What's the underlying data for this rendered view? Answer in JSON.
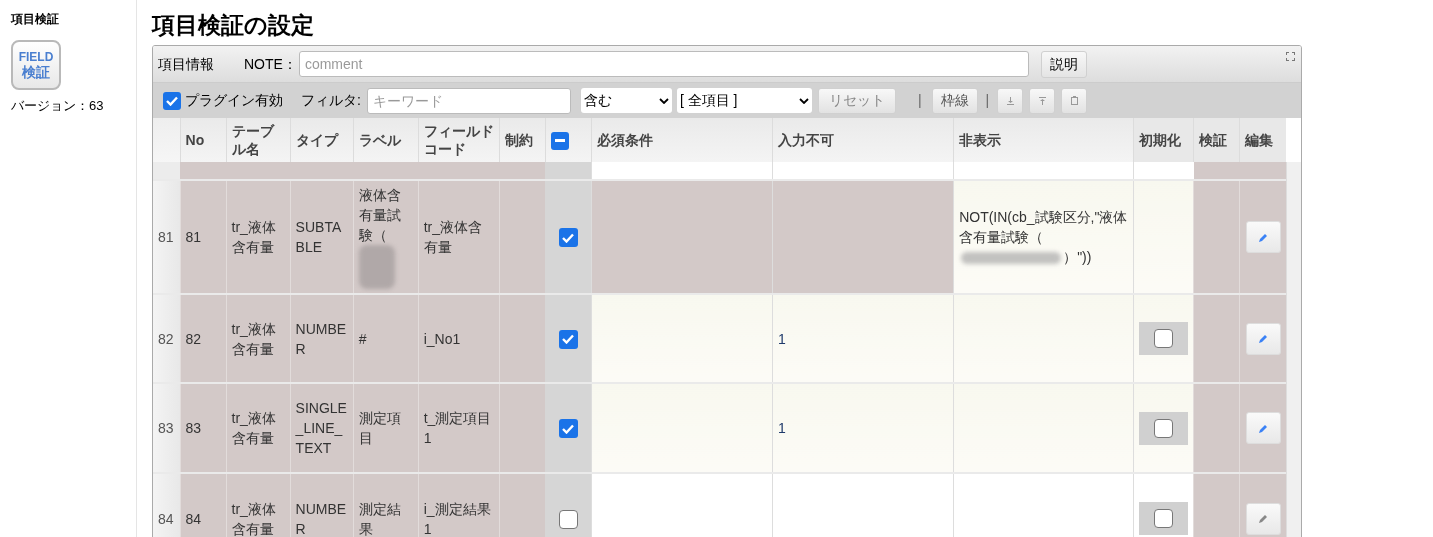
{
  "sidebar": {
    "title": "項目検証",
    "logo": {
      "line1": "FIELD",
      "line2": "検証"
    },
    "version": "バージョン：63"
  },
  "page_title": "項目検証の設定",
  "toolbar": {
    "label": "項目情報",
    "note_label": "NOTE：",
    "note": {
      "placeholder": "comment"
    },
    "help_button": "説明"
  },
  "filterbar": {
    "plugin_enabled": {
      "label": "プラグイン有効",
      "checked": true
    },
    "filter_label": "フィルタ:",
    "keyword": {
      "placeholder": "キーワード"
    },
    "match": "含む",
    "scope": "[ 全項目 ]",
    "reset_button": "リセット",
    "separator_1": "|",
    "border_button": "枠線",
    "separator_2": "|"
  },
  "table": {
    "columns": [
      "No",
      "テーブル名",
      "タイプ",
      "ラベル",
      "フィールドコード",
      "制約",
      "",
      "必須条件",
      "入力不可",
      "非表示",
      "初期化",
      "検証",
      "編集"
    ],
    "select_all_indeterminate": true,
    "rows": [
      {
        "row_number": "81",
        "no": "81",
        "table": "tr_液体含有量",
        "type": "SUBTABLE",
        "label": "液体含有量試験（",
        "field_code": "tr_液体含有量",
        "checked": true,
        "required": {
          "kind": "locked"
        },
        "readonly": {
          "kind": "locked"
        },
        "hidden": {
          "kind": "filled",
          "value": "NOT(IN(cb_試験区分,\"液体含有量試験（",
          "redacted": true,
          "tail": "）\"))"
        },
        "init": null,
        "edit_enabled": true
      },
      {
        "row_number": "82",
        "no": "82",
        "table": "tr_液体含有量",
        "type": "NUMBER",
        "label": "#",
        "field_code": "i_No1",
        "checked": true,
        "required": {
          "kind": "filled"
        },
        "readonly": {
          "kind": "filled",
          "value": "1"
        },
        "hidden": {
          "kind": "filled"
        },
        "init": {
          "checked": false
        },
        "edit_enabled": true
      },
      {
        "row_number": "83",
        "no": "83",
        "table": "tr_液体含有量",
        "type": "SINGLE_LINE_TEXT",
        "label": "測定項目",
        "field_code": "t_測定項目1",
        "checked": true,
        "required": {
          "kind": "filled"
        },
        "readonly": {
          "kind": "filled",
          "value": "1"
        },
        "hidden": {
          "kind": "filled"
        },
        "init": {
          "checked": false
        },
        "edit_enabled": true
      },
      {
        "row_number": "84",
        "no": "84",
        "table": "tr_液体含有量",
        "type": "NUMBER",
        "label": "測定結果",
        "field_code": "i_測定結果1",
        "checked": false,
        "required": {
          "kind": "blank"
        },
        "readonly": {
          "kind": "blank"
        },
        "hidden": {
          "kind": "blank"
        },
        "init": {
          "checked": false
        },
        "edit_enabled": false
      }
    ]
  }
}
